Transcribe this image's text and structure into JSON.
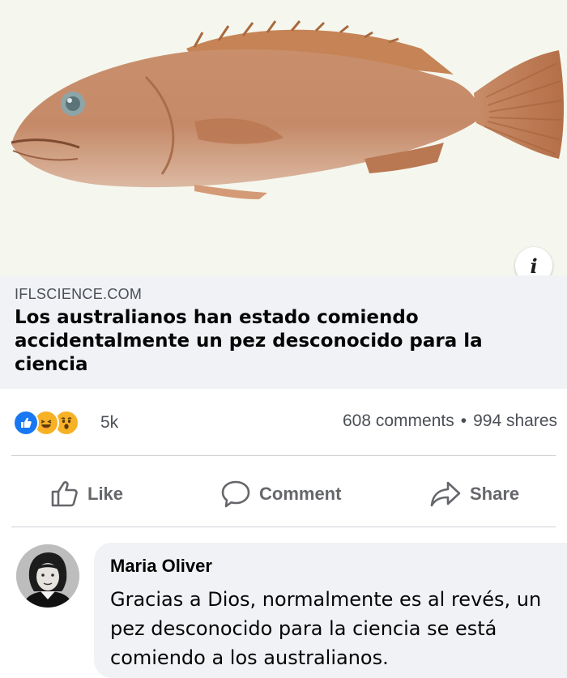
{
  "link_preview": {
    "image_alt": "fish",
    "domain": "IFLSCIENCE.COM",
    "title": "Los australianos han estado comiendo accidentalmente un pez desconocido para la ciencia",
    "info_badge": "i"
  },
  "reactions": {
    "icons": [
      "like-icon",
      "haha-icon",
      "wow-icon"
    ],
    "count": "5k",
    "comments": "608 comments",
    "separator": "•",
    "shares": "994 shares"
  },
  "actions": {
    "like": "Like",
    "comment": "Comment",
    "share": "Share"
  },
  "comment": {
    "author": "Maria Oliver",
    "text": "Gracias a Dios, normalmente es al revés, un pez desconocido para la ciencia se está comiendo a los australianos."
  },
  "colors": {
    "facebook_blue": "#1877f2",
    "reaction_yellow": "#f7b125",
    "muted_text": "#65676b",
    "bubble_bg": "#f0f2f5"
  }
}
